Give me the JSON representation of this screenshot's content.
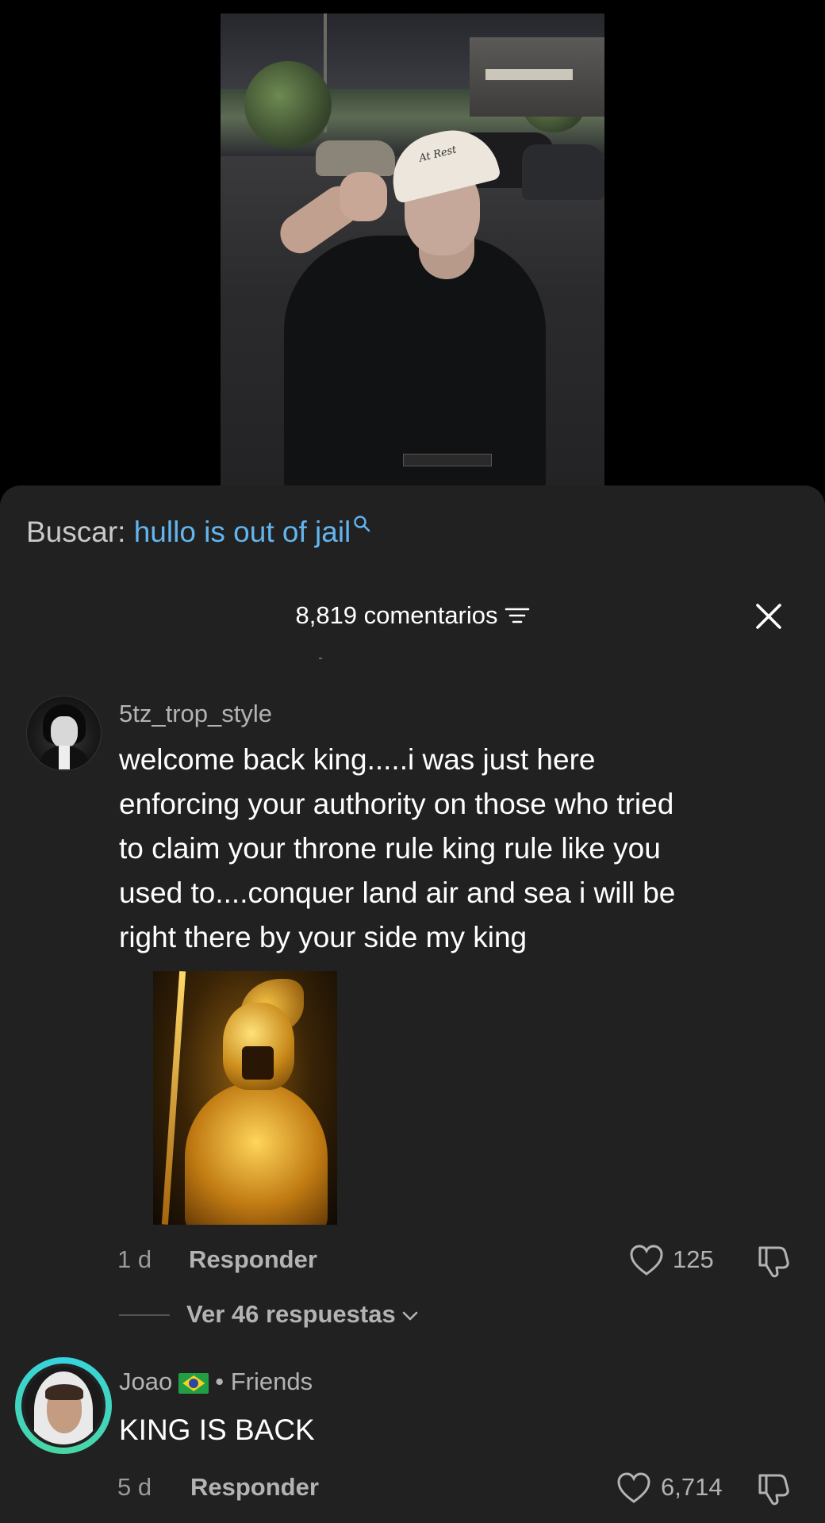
{
  "video": {
    "cap_text": "At Rest"
  },
  "search": {
    "label": "Buscar:",
    "query": "hullo is out of jail"
  },
  "header": {
    "count_label": "8,819 comentarios"
  },
  "comments": [
    {
      "username": "5tz_trop_style",
      "text_lines": [
        "welcome back king.....i was just here",
        "enforcing your authority on those who tried",
        "to claim your throne rule king rule like you",
        "used to....conquer land air and sea i will be",
        "right there by your side my king"
      ],
      "has_sticker": true,
      "time": "1 d",
      "reply_label": "Responder",
      "likes": "125",
      "view_replies": "Ver 46 respuestas"
    },
    {
      "username": "Joao",
      "flag": "brazil-flag",
      "tag": "• Friends",
      "text": "KING IS BACK",
      "time": "5 d",
      "reply_label": "Responder",
      "likes": "6,714"
    }
  ],
  "colors": {
    "sheet_bg": "#212121",
    "query_blue": "#63b5f0",
    "muted": "#b3b3b3"
  }
}
